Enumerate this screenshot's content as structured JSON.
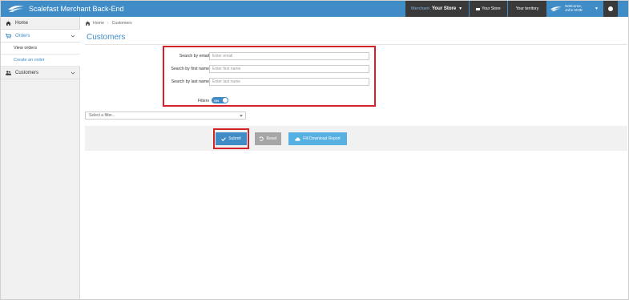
{
  "header": {
    "app_title": "Scalefast Merchant Back-End",
    "store_label": "Merchant",
    "store_value": "Your Store",
    "store2_label": "Your Store",
    "territory_label": "Your territory",
    "welcome_line1": "Welcome,",
    "welcome_line2": "John DOE"
  },
  "sidebar": {
    "items": [
      {
        "label": "Home"
      },
      {
        "label": "Orders"
      },
      {
        "label": "View orders"
      },
      {
        "label": "Create an order"
      },
      {
        "label": "Customers"
      }
    ]
  },
  "breadcrumb": {
    "home": "Home",
    "current": "Customers"
  },
  "page": {
    "title": "Customers"
  },
  "search": {
    "email_label": "Search by email",
    "email_placeholder": "Enter email",
    "first_label": "Search by first name",
    "first_placeholder": "Enter first name",
    "last_label": "Search by last name",
    "last_placeholder": "Enter last name",
    "filters_label": "Filters",
    "toggle_text": "ON"
  },
  "filter_select": {
    "placeholder": "Select a filter..."
  },
  "actions": {
    "submit": "Submit",
    "reset": "Reset",
    "report": "Fill Download Report"
  },
  "colors": {
    "brand_blue": "#3f8cc7",
    "dark_nav": "#3a3a3a",
    "highlight_red": "#d3222a"
  }
}
